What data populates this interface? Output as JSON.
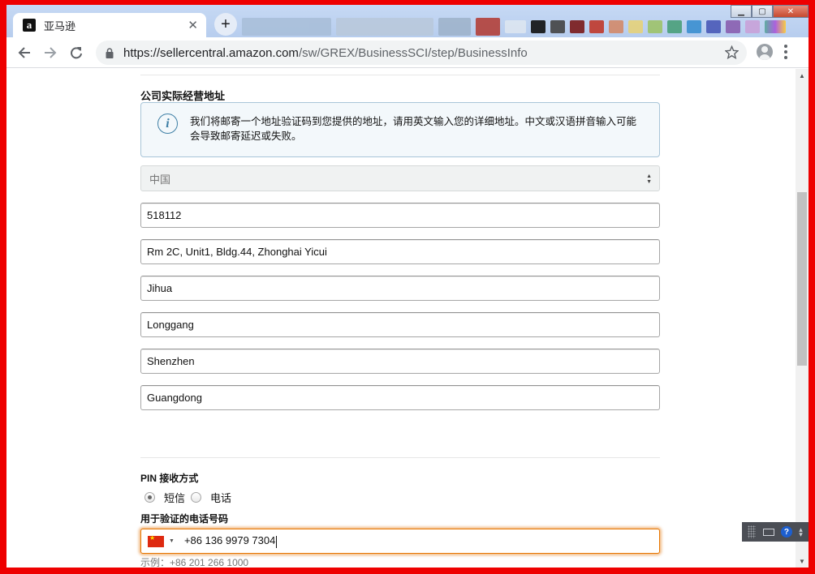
{
  "browser": {
    "tab_title": "亚马逊",
    "favicon_letter": "a",
    "url_host": "https://sellercentral.amazon.com",
    "url_path": "/sw/GREX/BusinessSCI/step/BusinessInfo"
  },
  "address_section": {
    "title": "公司实际经营地址",
    "info_text": "我们将邮寄一个地址验证码到您提供的地址，请用英文输入您的详细地址。中文或汉语拼音输入可能会导致邮寄延迟或失败。",
    "country_value": "中国",
    "postal_code": "518112",
    "address_line": "Rm 2C, Unit1, Bldg.44, Zhonghai Yicui",
    "district": "Jihua",
    "area": "Longgang",
    "city": "Shenzhen",
    "province": "Guangdong"
  },
  "pin_section": {
    "title": "PIN 接收方式",
    "option_sms": "短信",
    "option_call": "电话",
    "selected_option": "短信",
    "phone_label": "用于验证的电话号码",
    "phone_value": "+86 136 9979 7304",
    "phone_hint": "示例：+86 201 266 1000"
  },
  "colors": {
    "frame": "#ee0000",
    "focus_orange": "#e77600",
    "info_border": "#a8c5d8",
    "info_icon": "#3e7fa5"
  },
  "icons": [
    "amazon-favicon",
    "close-icon",
    "plus-icon",
    "back-arrow-icon",
    "forward-arrow-icon",
    "reload-icon",
    "lock-icon",
    "star-icon",
    "profile-icon",
    "menu-icon",
    "info-icon",
    "china-flag-icon",
    "keyboard-icon",
    "help-icon"
  ]
}
